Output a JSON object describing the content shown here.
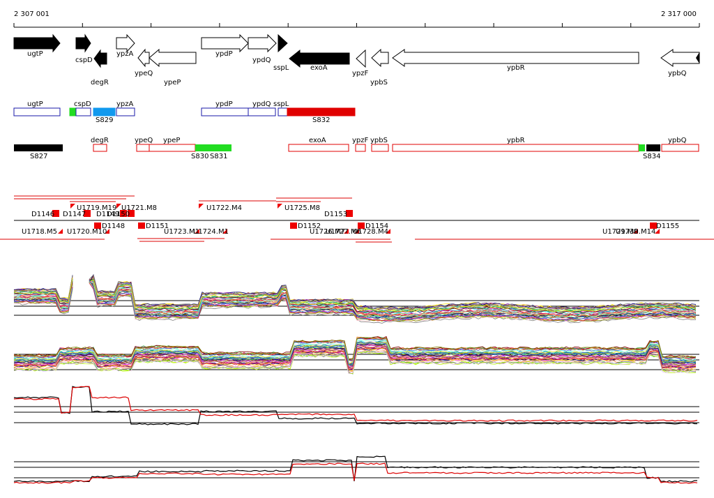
{
  "ruler": {
    "start_label": "2 307 001",
    "end_label": "2 317 000"
  },
  "colors": {
    "feature_black": "#000000",
    "segment_blue": "#1a1aaa",
    "segment_red": "#e00000",
    "segment_green": "#22dd22",
    "segment_cyan": "#1199ee",
    "probe_red": "#ee0000",
    "trace_black": "#000000",
    "trace_red": "#dd0000"
  },
  "genes": [
    {
      "name": "ugtP",
      "strand": "+",
      "filled": true
    },
    {
      "name": "cspD",
      "strand": "+",
      "filled": true
    },
    {
      "name": "degR",
      "strand": "-",
      "filled": true
    },
    {
      "name": "ypzA",
      "strand": "+",
      "filled": false
    },
    {
      "name": "ypeQ",
      "strand": "-",
      "filled": false
    },
    {
      "name": "ypeP",
      "strand": "-",
      "filled": false
    },
    {
      "name": "ypdP",
      "strand": "+",
      "filled": false
    },
    {
      "name": "ypdQ",
      "strand": "+",
      "filled": false
    },
    {
      "name": "sspL",
      "strand": "+",
      "filled": true
    },
    {
      "name": "exoA",
      "strand": "-",
      "filled": true
    },
    {
      "name": "ypzF",
      "strand": "-",
      "filled": false
    },
    {
      "name": "ypbS",
      "strand": "-",
      "filled": false
    },
    {
      "name": "ypbR",
      "strand": "-",
      "filled": false
    },
    {
      "name": "ypbQ",
      "strand": "-",
      "filled": false
    }
  ],
  "segments_plus": [
    {
      "label": "ugtP",
      "color": "blue"
    },
    {
      "label": "cspD",
      "color": "blue"
    },
    {
      "label": "S829",
      "color": "cyan"
    },
    {
      "label": "ypzA",
      "color": "blue"
    },
    {
      "label": "ypdP",
      "color": "blue"
    },
    {
      "label": "ypdQ",
      "color": "blue"
    },
    {
      "label": "sspL",
      "color": "blue"
    },
    {
      "label": "S832",
      "color": "red"
    }
  ],
  "segments_minus": [
    {
      "label": "S827",
      "color": "black"
    },
    {
      "label": "degR",
      "color": "red"
    },
    {
      "label": "ypeQ",
      "color": "red"
    },
    {
      "label": "ypeP",
      "color": "red"
    },
    {
      "label": "S830",
      "color": "green"
    },
    {
      "label": "S831",
      "color": "green"
    },
    {
      "label": "exoA",
      "color": "red"
    },
    {
      "label": "ypzF",
      "color": "red"
    },
    {
      "label": "ypbS",
      "color": "red"
    },
    {
      "label": "ypbR",
      "color": "red"
    },
    {
      "label": "S834",
      "color": "black"
    },
    {
      "label": "ypbQ",
      "color": "red"
    }
  ],
  "probes_top": [
    "D1146",
    "D1147",
    "U1719.M19",
    "D1149",
    "D1150",
    "U1721.M8",
    "U1722.M4",
    "U1725.M8",
    "D1153"
  ],
  "probes_bottom": [
    "U1718.M5",
    "U1720.M10",
    "D1148",
    "D1151",
    "U1723.M1",
    "U1724.M1",
    "D1152",
    "U1726.M7",
    "U1727.M6",
    "U1728.M4",
    "D1154",
    "U1729.M8",
    "U1730.M14",
    "D1155"
  ]
}
